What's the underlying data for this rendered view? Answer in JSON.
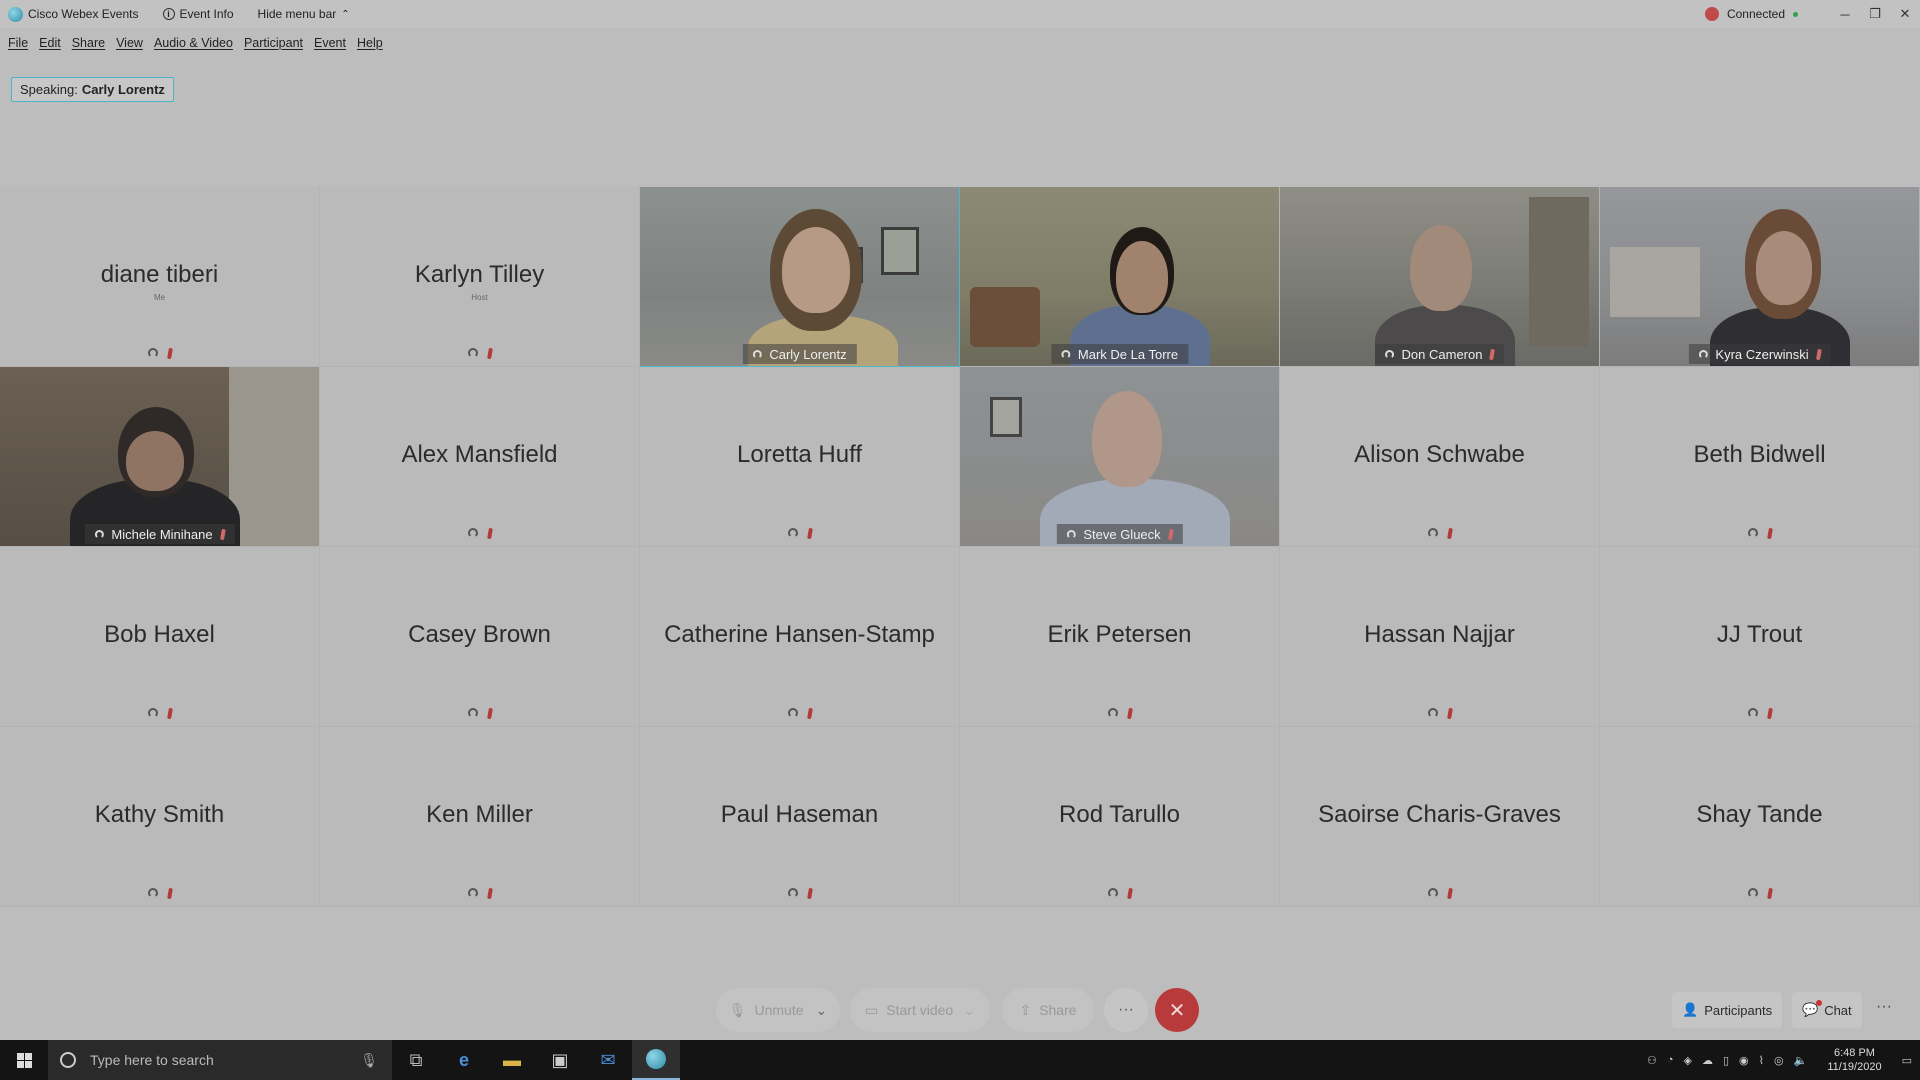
{
  "titlebar": {
    "app_name": "Cisco Webex Events",
    "event_info": "Event Info",
    "hide_menu": "Hide menu bar",
    "status": "Connected"
  },
  "menu": [
    "File",
    "Edit",
    "Share",
    "View",
    "Audio & Video",
    "Participant",
    "Event",
    "Help"
  ],
  "speaking": {
    "prefix": "Speaking:",
    "name": "Carly Lorentz"
  },
  "tiles": [
    {
      "name": "diane tiberi",
      "role": "Me",
      "video": false
    },
    {
      "name": "Karlyn Tilley",
      "role": "Host",
      "video": false
    },
    {
      "name": "Carly Lorentz",
      "video": true,
      "active": true
    },
    {
      "name": "Mark De La Torre",
      "video": true
    },
    {
      "name": "Don Cameron",
      "video": true
    },
    {
      "name": "Kyra Czerwinski",
      "video": true
    },
    {
      "name": "Michele Minihane",
      "video": true
    },
    {
      "name": "Alex Mansfield",
      "video": false
    },
    {
      "name": "Loretta Huff",
      "video": false
    },
    {
      "name": "Steve Glueck",
      "video": true
    },
    {
      "name": "Alison Schwabe",
      "video": false
    },
    {
      "name": "Beth Bidwell",
      "video": false
    },
    {
      "name": "Bob Haxel",
      "video": false
    },
    {
      "name": "Casey Brown",
      "video": false
    },
    {
      "name": "Catherine Hansen-Stamp",
      "video": false
    },
    {
      "name": "Erik Petersen",
      "video": false
    },
    {
      "name": "Hassan Najjar",
      "video": false
    },
    {
      "name": "JJ Trout",
      "video": false
    },
    {
      "name": "Kathy Smith",
      "video": false
    },
    {
      "name": "Ken Miller",
      "video": false
    },
    {
      "name": "Paul Haseman",
      "video": false
    },
    {
      "name": "Rod Tarullo",
      "video": false
    },
    {
      "name": "Saoirse Charis-Graves",
      "video": false
    },
    {
      "name": "Shay Tande",
      "video": false
    }
  ],
  "controls": {
    "unmute": "Unmute",
    "start_video": "Start video",
    "share": "Share",
    "more": "···",
    "participants": "Participants",
    "chat": "Chat"
  },
  "taskbar": {
    "search_placeholder": "Type here to search",
    "time": "6:48 PM",
    "date": "11/19/2020"
  },
  "colors": {
    "accent": "#4fb7c9",
    "end_call": "#b83a3a",
    "status_red": "#c04a4a"
  }
}
